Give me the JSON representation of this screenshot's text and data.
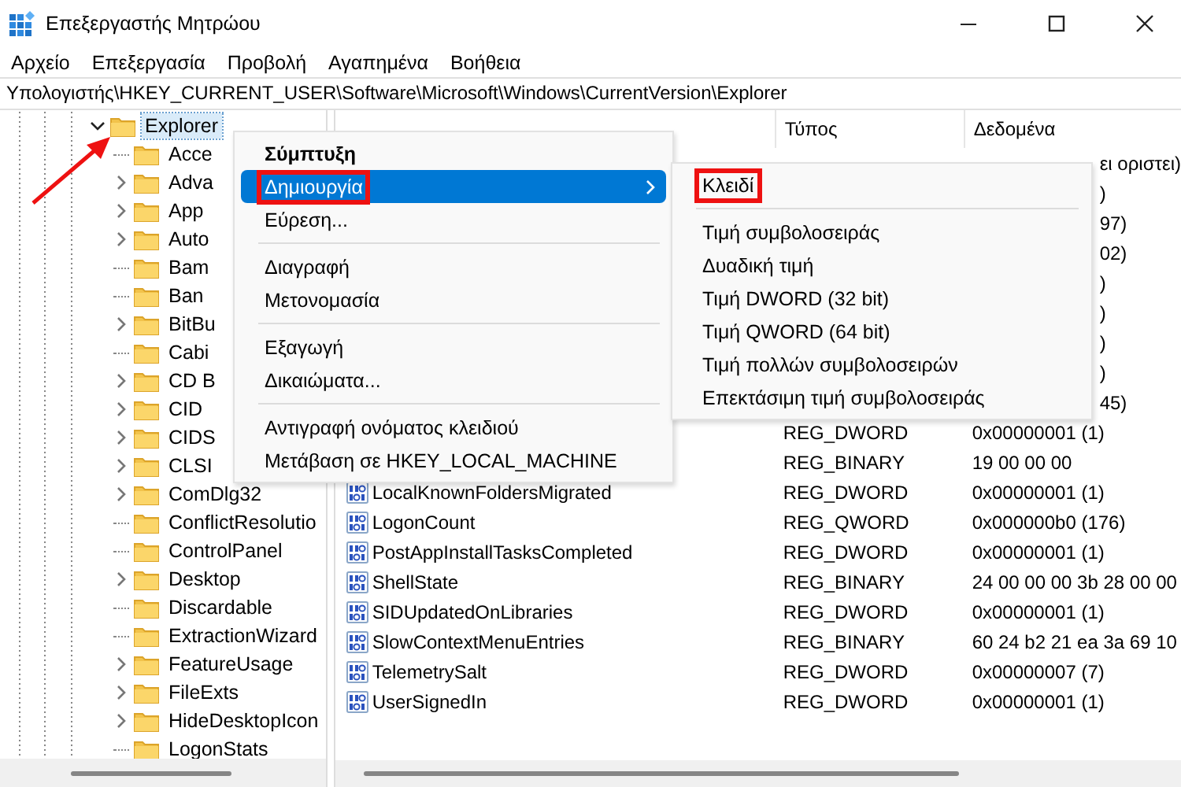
{
  "window": {
    "title": "Επεξεργαστής Μητρώου"
  },
  "menu_bar": [
    "Αρχείο",
    "Επεξεργασία",
    "Προβολή",
    "Αγαπημένα",
    "Βοήθεια"
  ],
  "address": "Υπολογιστής\\HKEY_CURRENT_USER\\Software\\Microsoft\\Windows\\CurrentVersion\\Explorer",
  "tree": {
    "label": "Explorer",
    "expanded": true,
    "selected": true,
    "annotated": true,
    "children": [
      {
        "label": "Acce",
        "expandable": false,
        "selected": false
      },
      {
        "label": "Adva",
        "expandable": true,
        "selected": false
      },
      {
        "label": "App",
        "expandable": true,
        "selected": false
      },
      {
        "label": "Auto",
        "expandable": true,
        "selected": false
      },
      {
        "label": "Bam",
        "expandable": false,
        "selected": false
      },
      {
        "label": "Ban",
        "expandable": false,
        "selected": false
      },
      {
        "label": "BitBu",
        "expandable": true,
        "selected": false
      },
      {
        "label": "Cabi",
        "expandable": false,
        "selected": false
      },
      {
        "label": "CD B",
        "expandable": true,
        "selected": false
      },
      {
        "label": "CID",
        "expandable": true,
        "selected": false
      },
      {
        "label": "CIDS",
        "expandable": true,
        "selected": false
      },
      {
        "label": "CLSI",
        "expandable": true,
        "selected": false
      },
      {
        "label": "ComDlg32",
        "expandable": true,
        "selected": false
      },
      {
        "label": "ConflictResolutio",
        "expandable": false,
        "selected": false
      },
      {
        "label": "ControlPanel",
        "expandable": false,
        "selected": false
      },
      {
        "label": "Desktop",
        "expandable": true,
        "selected": false
      },
      {
        "label": "Discardable",
        "expandable": false,
        "selected": false
      },
      {
        "label": "ExtractionWizard",
        "expandable": false,
        "selected": false
      },
      {
        "label": "FeatureUsage",
        "expandable": true,
        "selected": false
      },
      {
        "label": "FileExts",
        "expandable": true,
        "selected": false
      },
      {
        "label": "HideDesktopIcon",
        "expandable": true,
        "selected": false
      },
      {
        "label": "LogonStats",
        "expandable": false,
        "selected": false
      }
    ]
  },
  "values": {
    "columns": [
      "Τύπος",
      "Δεδομένα"
    ],
    "rows": [
      {
        "kind": "clipped",
        "data": "ει οριστει)",
        "selected": false
      },
      {
        "kind": "clipped",
        "data": ")",
        "selected": false
      },
      {
        "kind": "clipped",
        "data": "97)",
        "selected": false
      },
      {
        "kind": "clipped",
        "data": "02)",
        "selected": false
      },
      {
        "kind": "clipped",
        "data": ")",
        "selected": false
      },
      {
        "kind": "clipped",
        "data": ")",
        "selected": false
      },
      {
        "kind": "clipped",
        "data": ")",
        "selected": false
      },
      {
        "kind": "clipped",
        "data": ")",
        "selected": false
      },
      {
        "kind": "clipped",
        "data": "45)",
        "selected": false
      },
      {
        "kind": "value",
        "type": "REG_DWORD",
        "data": "0x00000001 (1)",
        "selected": false
      },
      {
        "kind": "value",
        "type": "REG_BINARY",
        "data": "19 00 00 00",
        "selected": false
      },
      {
        "kind": "value",
        "name": "LocalKnownFoldersMigrated",
        "type": "REG_DWORD",
        "data": "0x00000001 (1)",
        "selected": false
      },
      {
        "kind": "value",
        "name": "LogonCount",
        "type": "REG_QWORD",
        "data": "0x000000b0 (176)",
        "selected": false
      },
      {
        "kind": "value",
        "name": "PostAppInstallTasksCompleted",
        "type": "REG_DWORD",
        "data": "0x00000001 (1)",
        "selected": false
      },
      {
        "kind": "value",
        "name": "ShellState",
        "type": "REG_BINARY",
        "data": "24 00 00 00 3b 28 00 00",
        "selected": false
      },
      {
        "kind": "value",
        "name": "SIDUpdatedOnLibraries",
        "type": "REG_DWORD",
        "data": "0x00000001 (1)",
        "selected": false
      },
      {
        "kind": "value",
        "name": "SlowContextMenuEntries",
        "type": "REG_BINARY",
        "data": "60 24 b2 21 ea 3a 69 10",
        "selected": false
      },
      {
        "kind": "value",
        "name": "TelemetrySalt",
        "type": "REG_DWORD",
        "data": "0x00000007 (7)",
        "selected": false
      },
      {
        "kind": "value",
        "name": "UserSignedIn",
        "type": "REG_DWORD",
        "data": "0x00000001 (1)",
        "selected": false
      }
    ]
  },
  "context_menu": {
    "items": [
      {
        "kind": "default",
        "label": "Σύμπτυξη",
        "selected": false,
        "annotated": false
      },
      {
        "kind": "submenu",
        "label": "Δημιουργία",
        "selected": true,
        "annotated": true
      },
      {
        "kind": "item",
        "label": "Εύρεση...",
        "selected": false,
        "annotated": false
      },
      {
        "kind": "separator"
      },
      {
        "kind": "item",
        "label": "Διαγραφή",
        "selected": false,
        "annotated": false
      },
      {
        "kind": "item",
        "label": "Μετονομασία",
        "selected": false,
        "annotated": false
      },
      {
        "kind": "separator"
      },
      {
        "kind": "item",
        "label": "Εξαγωγή",
        "selected": false,
        "annotated": false
      },
      {
        "kind": "item",
        "label": "Δικαιώματα...",
        "selected": false,
        "annotated": false
      },
      {
        "kind": "separator"
      },
      {
        "kind": "item",
        "label": "Αντιγραφή ονόματος κλειδιού",
        "selected": false,
        "annotated": false
      },
      {
        "kind": "item",
        "label": "Μετάβαση σε HKEY_LOCAL_MACHINE",
        "selected": false,
        "annotated": false
      }
    ]
  },
  "submenu": {
    "items": [
      {
        "kind": "item",
        "label": "Κλειδί",
        "selected": false,
        "annotated": true
      },
      {
        "kind": "separator"
      },
      {
        "kind": "item",
        "label": "Τιμή συμβολοσειράς",
        "selected": false,
        "annotated": false
      },
      {
        "kind": "item",
        "label": "Δυαδική τιμή",
        "selected": false,
        "annotated": false
      },
      {
        "kind": "item",
        "label": "Τιμή DWORD (32 bit)",
        "selected": false,
        "annotated": false
      },
      {
        "kind": "item",
        "label": "Τιμή QWORD (64 bit)",
        "selected": false,
        "annotated": false
      },
      {
        "kind": "item",
        "label": "Τιμή πολλών συμβολοσειρών",
        "selected": false,
        "annotated": false
      },
      {
        "kind": "item",
        "label": "Επεκτάσιμη τιμή συμβολοσειράς",
        "selected": false,
        "annotated": false
      }
    ]
  }
}
